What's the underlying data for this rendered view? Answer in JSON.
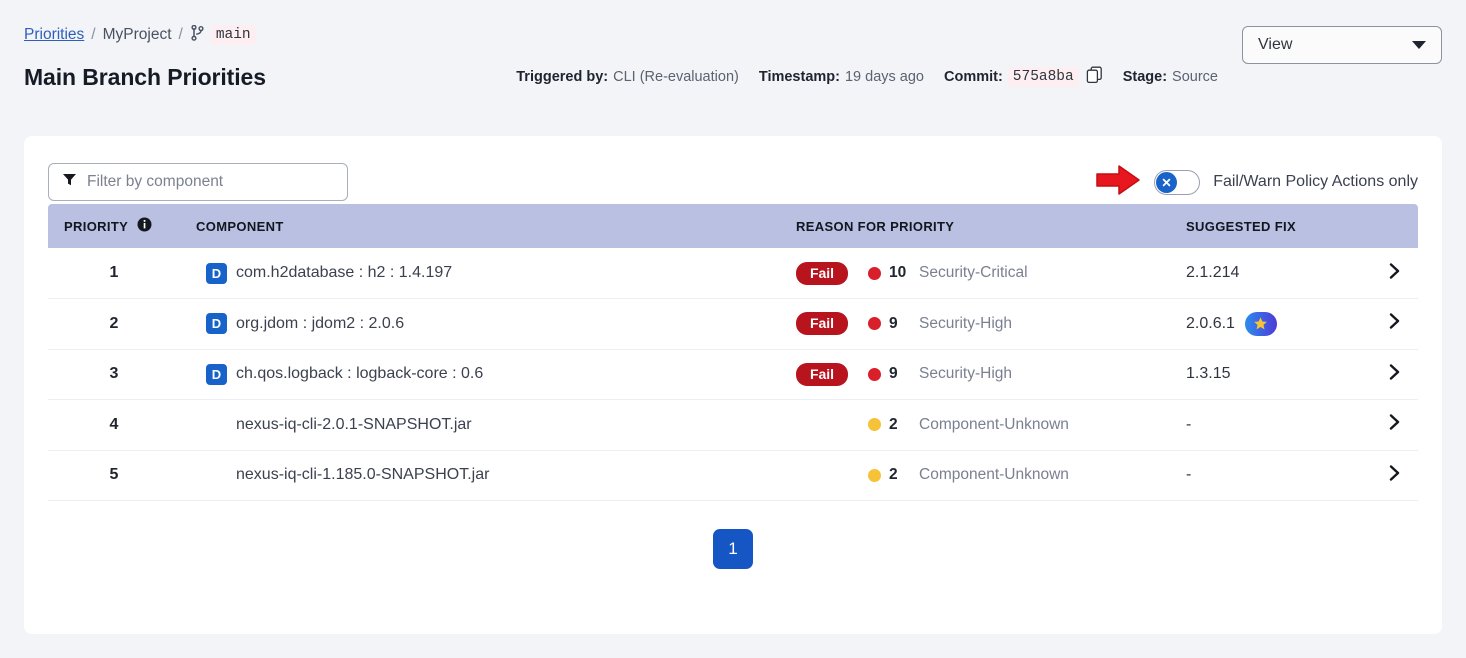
{
  "breadcrumb": {
    "root_label": "Priorities",
    "separator": "/",
    "project_label": "MyProject",
    "branch_label": "main",
    "branch_icon": "git-branch-icon"
  },
  "header": {
    "view_button_label": "View",
    "title": "Main Branch Priorities",
    "meta": [
      {
        "label": "Triggered by:",
        "value": "CLI (Re-evaluation)"
      },
      {
        "label": "Timestamp:",
        "value": "19 days ago"
      },
      {
        "label": "Commit:",
        "value": "575a8ba"
      },
      {
        "label": "Stage:",
        "value": "Source"
      }
    ],
    "copy_icon": "copy-icon"
  },
  "toolbar": {
    "filter_placeholder": "Filter by component",
    "filter_value": "",
    "filter_icon": "funnel-icon",
    "toggle_label": "Fail/Warn Policy Actions only",
    "toggle_state": "off",
    "annotation_arrow": "red-arrow-pointer"
  },
  "table": {
    "columns": {
      "priority": "PRIORITY",
      "component": "COMPONENT",
      "reason": "REASON FOR PRIORITY",
      "fix": "SUGGESTED FIX"
    },
    "priority_info_icon": "info-icon",
    "rows": [
      {
        "priority": "1",
        "badge": "D",
        "component": "com.h2database : h2 : 1.4.197",
        "action": "Fail",
        "threat": "10",
        "threat_color": "#d91f2a",
        "policy": "Security-Critical",
        "fix": "2.1.214",
        "recommended": false
      },
      {
        "priority": "2",
        "badge": "D",
        "component": "org.jdom : jdom2 : 2.0.6",
        "action": "Fail",
        "threat": "9",
        "threat_color": "#d91f2a",
        "policy": "Security-High",
        "fix": "2.0.6.1",
        "recommended": true
      },
      {
        "priority": "3",
        "badge": "D",
        "component": "ch.qos.logback : logback-core : 0.6",
        "action": "Fail",
        "threat": "9",
        "threat_color": "#d91f2a",
        "policy": "Security-High",
        "fix": "1.3.15",
        "recommended": false
      },
      {
        "priority": "4",
        "badge": "",
        "component": "nexus-iq-cli-2.0.1-SNAPSHOT.jar",
        "action": "",
        "threat": "2",
        "threat_color": "#f6c238",
        "policy": "Component-Unknown",
        "fix": "-",
        "recommended": false
      },
      {
        "priority": "5",
        "badge": "",
        "component": "nexus-iq-cli-1.185.0-SNAPSHOT.jar",
        "action": "",
        "threat": "2",
        "threat_color": "#f6c238",
        "policy": "Component-Unknown",
        "fix": "-",
        "recommended": false
      }
    ],
    "row_chevron_icon": "chevron-right-icon"
  },
  "pagination": {
    "current_page": "1"
  },
  "colors": {
    "accent_blue": "#1763c9",
    "fail_red": "#b8141e",
    "header_lavender": "#b9c0e2",
    "warn_yellow": "#f6c238",
    "page_bg": "#f2f4f8"
  }
}
